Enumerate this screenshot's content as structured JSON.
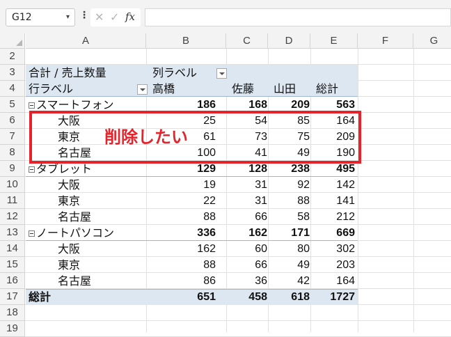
{
  "formula_bar": {
    "name_box": "G12",
    "cancel_icon": "✕",
    "enter_icon": "✓",
    "fx_label": "fx",
    "formula": ""
  },
  "columns": [
    "A",
    "B",
    "C",
    "D",
    "E",
    "F",
    "G"
  ],
  "rows": [
    "2",
    "3",
    "4",
    "5",
    "6",
    "7",
    "8",
    "9",
    "10",
    "11",
    "12",
    "13",
    "14",
    "15",
    "16",
    "17",
    "18",
    "19"
  ],
  "pivot": {
    "value_label": "合計 / 売上数量",
    "column_label_caption": "列ラベル",
    "row_label_caption": "行ラベル",
    "col_headers": [
      "高橋",
      "佐藤",
      "山田",
      "総計"
    ],
    "groups": [
      {
        "name": "スマートフォン",
        "totals": [
          "186",
          "168",
          "209",
          "563"
        ],
        "items": [
          {
            "name": "大阪",
            "values": [
              "25",
              "54",
              "85",
              "164"
            ]
          },
          {
            "name": "東京",
            "values": [
              "61",
              "73",
              "75",
              "209"
            ]
          },
          {
            "name": "名古屋",
            "values": [
              "100",
              "41",
              "49",
              "190"
            ]
          }
        ]
      },
      {
        "name": "タブレット",
        "totals": [
          "129",
          "128",
          "238",
          "495"
        ],
        "items": [
          {
            "name": "大阪",
            "values": [
              "19",
              "31",
              "92",
              "142"
            ]
          },
          {
            "name": "東京",
            "values": [
              "22",
              "31",
              "88",
              "141"
            ]
          },
          {
            "name": "名古屋",
            "values": [
              "88",
              "66",
              "58",
              "212"
            ]
          }
        ]
      },
      {
        "name": "ノートパソコン",
        "totals": [
          "336",
          "162",
          "171",
          "669"
        ],
        "items": [
          {
            "name": "大阪",
            "values": [
              "162",
              "60",
              "80",
              "302"
            ]
          },
          {
            "name": "東京",
            "values": [
              "88",
              "66",
              "49",
              "203"
            ]
          },
          {
            "name": "名古屋",
            "values": [
              "86",
              "36",
              "42",
              "164"
            ]
          }
        ]
      }
    ],
    "grand_total_label": "総計",
    "grand_totals": [
      "651",
      "458",
      "618",
      "1727"
    ]
  },
  "annotation": {
    "text": "削除したい",
    "color": "#e5232b"
  },
  "colors": {
    "header_band": "#dde7f1",
    "highlight": "#e5232b"
  }
}
